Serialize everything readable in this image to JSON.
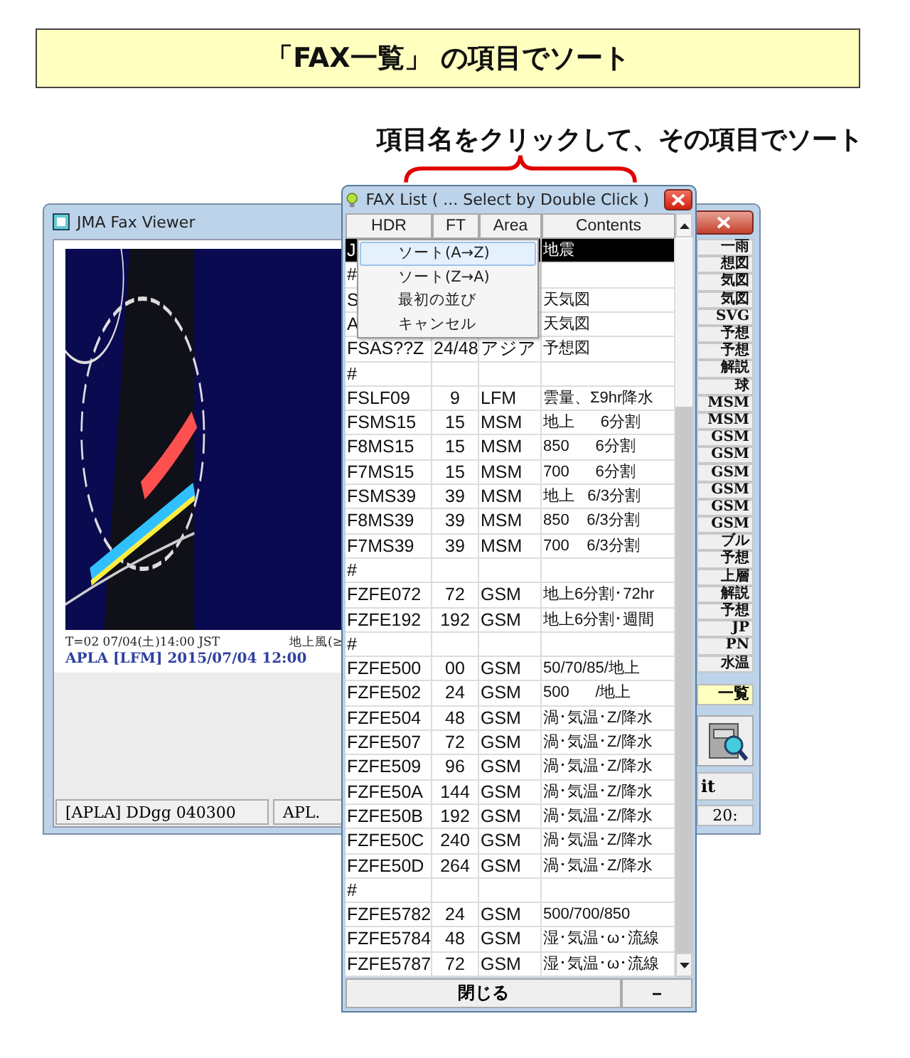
{
  "banner": {
    "title": "「FAX一覧」 の項目でソート"
  },
  "caption": "項目名をクリックして、その項目でソート",
  "viewer": {
    "title": "JMA Fax Viewer",
    "map_caption_left": "T=02  07/04(土)14:00 JST",
    "map_caption_right": "地上風(≥",
    "map_title": "APLA [LFM] 2015/07/04  12:00",
    "side_buttons": [
      "一雨",
      "想図",
      "気図",
      "気図",
      "SVG",
      "予想",
      "予想",
      "解説",
      "球",
      "MSM",
      "MSM",
      "GSM",
      "GSM",
      "GSM",
      "GSM",
      "GSM",
      "GSM",
      "ブル",
      "予想",
      "上層",
      "解説",
      "予想",
      "JP",
      "PN",
      "水温"
    ],
    "list_button": "一覧",
    "exit_button": "it",
    "status": [
      "[APLA] DDgg 040300",
      "APL."
    ],
    "clock": "20:"
  },
  "fax_list": {
    "title": "FAX List ( ... Select by Double Click )",
    "columns": [
      "HDR",
      "FT",
      "Area",
      "Contents"
    ],
    "rows": [
      {
        "hdr": "J",
        "ft": "",
        "area": "",
        "contents": "地震",
        "selected": true
      },
      {
        "hdr": "#",
        "ft": "",
        "area": "",
        "contents": "",
        "selected": false
      },
      {
        "hdr": "S",
        "ft": "",
        "area": "",
        "contents": "天気図",
        "selected": false
      },
      {
        "hdr": "A",
        "ft": "",
        "area": "",
        "contents": "天気図",
        "selected": false
      },
      {
        "hdr": "FSAS??Z",
        "ft": "24/48",
        "area": "アジア",
        "contents": "予想図",
        "selected": false
      },
      {
        "hdr": "#",
        "ft": "",
        "area": "",
        "contents": "",
        "selected": false
      },
      {
        "hdr": "FSLF09",
        "ft": "9",
        "area": "LFM",
        "contents": "雲量、Σ9hr降水",
        "selected": false
      },
      {
        "hdr": "FSMS15",
        "ft": "15",
        "area": "MSM",
        "contents": "地上      6分割",
        "selected": false
      },
      {
        "hdr": "F8MS15",
        "ft": "15",
        "area": "MSM",
        "contents": "850      6分割",
        "selected": false
      },
      {
        "hdr": "F7MS15",
        "ft": "15",
        "area": "MSM",
        "contents": "700      6分割",
        "selected": false
      },
      {
        "hdr": "FSMS39",
        "ft": "39",
        "area": "MSM",
        "contents": "地上   6/3分割",
        "selected": false
      },
      {
        "hdr": "F8MS39",
        "ft": "39",
        "area": "MSM",
        "contents": "850    6/3分割",
        "selected": false
      },
      {
        "hdr": "F7MS39",
        "ft": "39",
        "area": "MSM",
        "contents": "700    6/3分割",
        "selected": false
      },
      {
        "hdr": "#",
        "ft": "",
        "area": "",
        "contents": "",
        "selected": false
      },
      {
        "hdr": "FZFE072",
        "ft": "72",
        "area": "GSM",
        "contents": "地上6分割･72hr",
        "selected": false
      },
      {
        "hdr": "FZFE192",
        "ft": "192",
        "area": "GSM",
        "contents": "地上6分割･週間",
        "selected": false
      },
      {
        "hdr": "#",
        "ft": "",
        "area": "",
        "contents": "",
        "selected": false
      },
      {
        "hdr": "FZFE500",
        "ft": "00",
        "area": "GSM",
        "contents": "50/70/85/地上",
        "selected": false
      },
      {
        "hdr": "FZFE502",
        "ft": "24",
        "area": "GSM",
        "contents": "500      /地上",
        "selected": false
      },
      {
        "hdr": "FZFE504",
        "ft": "48",
        "area": "GSM",
        "contents": "渦･気温･Z/降水",
        "selected": false
      },
      {
        "hdr": "FZFE507",
        "ft": "72",
        "area": "GSM",
        "contents": "渦･気温･Z/降水",
        "selected": false
      },
      {
        "hdr": "FZFE509",
        "ft": "96",
        "area": "GSM",
        "contents": "渦･気温･Z/降水",
        "selected": false
      },
      {
        "hdr": "FZFE50A",
        "ft": "144",
        "area": "GSM",
        "contents": "渦･気温･Z/降水",
        "selected": false
      },
      {
        "hdr": "FZFE50B",
        "ft": "192",
        "area": "GSM",
        "contents": "渦･気温･Z/降水",
        "selected": false
      },
      {
        "hdr": "FZFE50C",
        "ft": "240",
        "area": "GSM",
        "contents": "渦･気温･Z/降水",
        "selected": false
      },
      {
        "hdr": "FZFE50D",
        "ft": "264",
        "area": "GSM",
        "contents": "渦･気温･Z/降水",
        "selected": false
      },
      {
        "hdr": "#",
        "ft": "",
        "area": "",
        "contents": "",
        "selected": false
      },
      {
        "hdr": "FZFE5782",
        "ft": "24",
        "area": "GSM",
        "contents": "500/700/850",
        "selected": false
      },
      {
        "hdr": "FZFE5784",
        "ft": "48",
        "area": "GSM",
        "contents": "湿･気温･ω･流線",
        "selected": false
      },
      {
        "hdr": "FZFE5787",
        "ft": "72",
        "area": "GSM",
        "contents": "湿･気温･ω･流線",
        "selected": false
      }
    ],
    "menu": [
      {
        "label": "ソート(A→Z)",
        "selected": true
      },
      {
        "label": "ソート(Z→A)",
        "selected": false
      },
      {
        "label": "最初の並び",
        "selected": false
      },
      {
        "label": "キャンセル",
        "selected": false
      }
    ],
    "buttons": [
      "閉じる",
      "−"
    ]
  }
}
